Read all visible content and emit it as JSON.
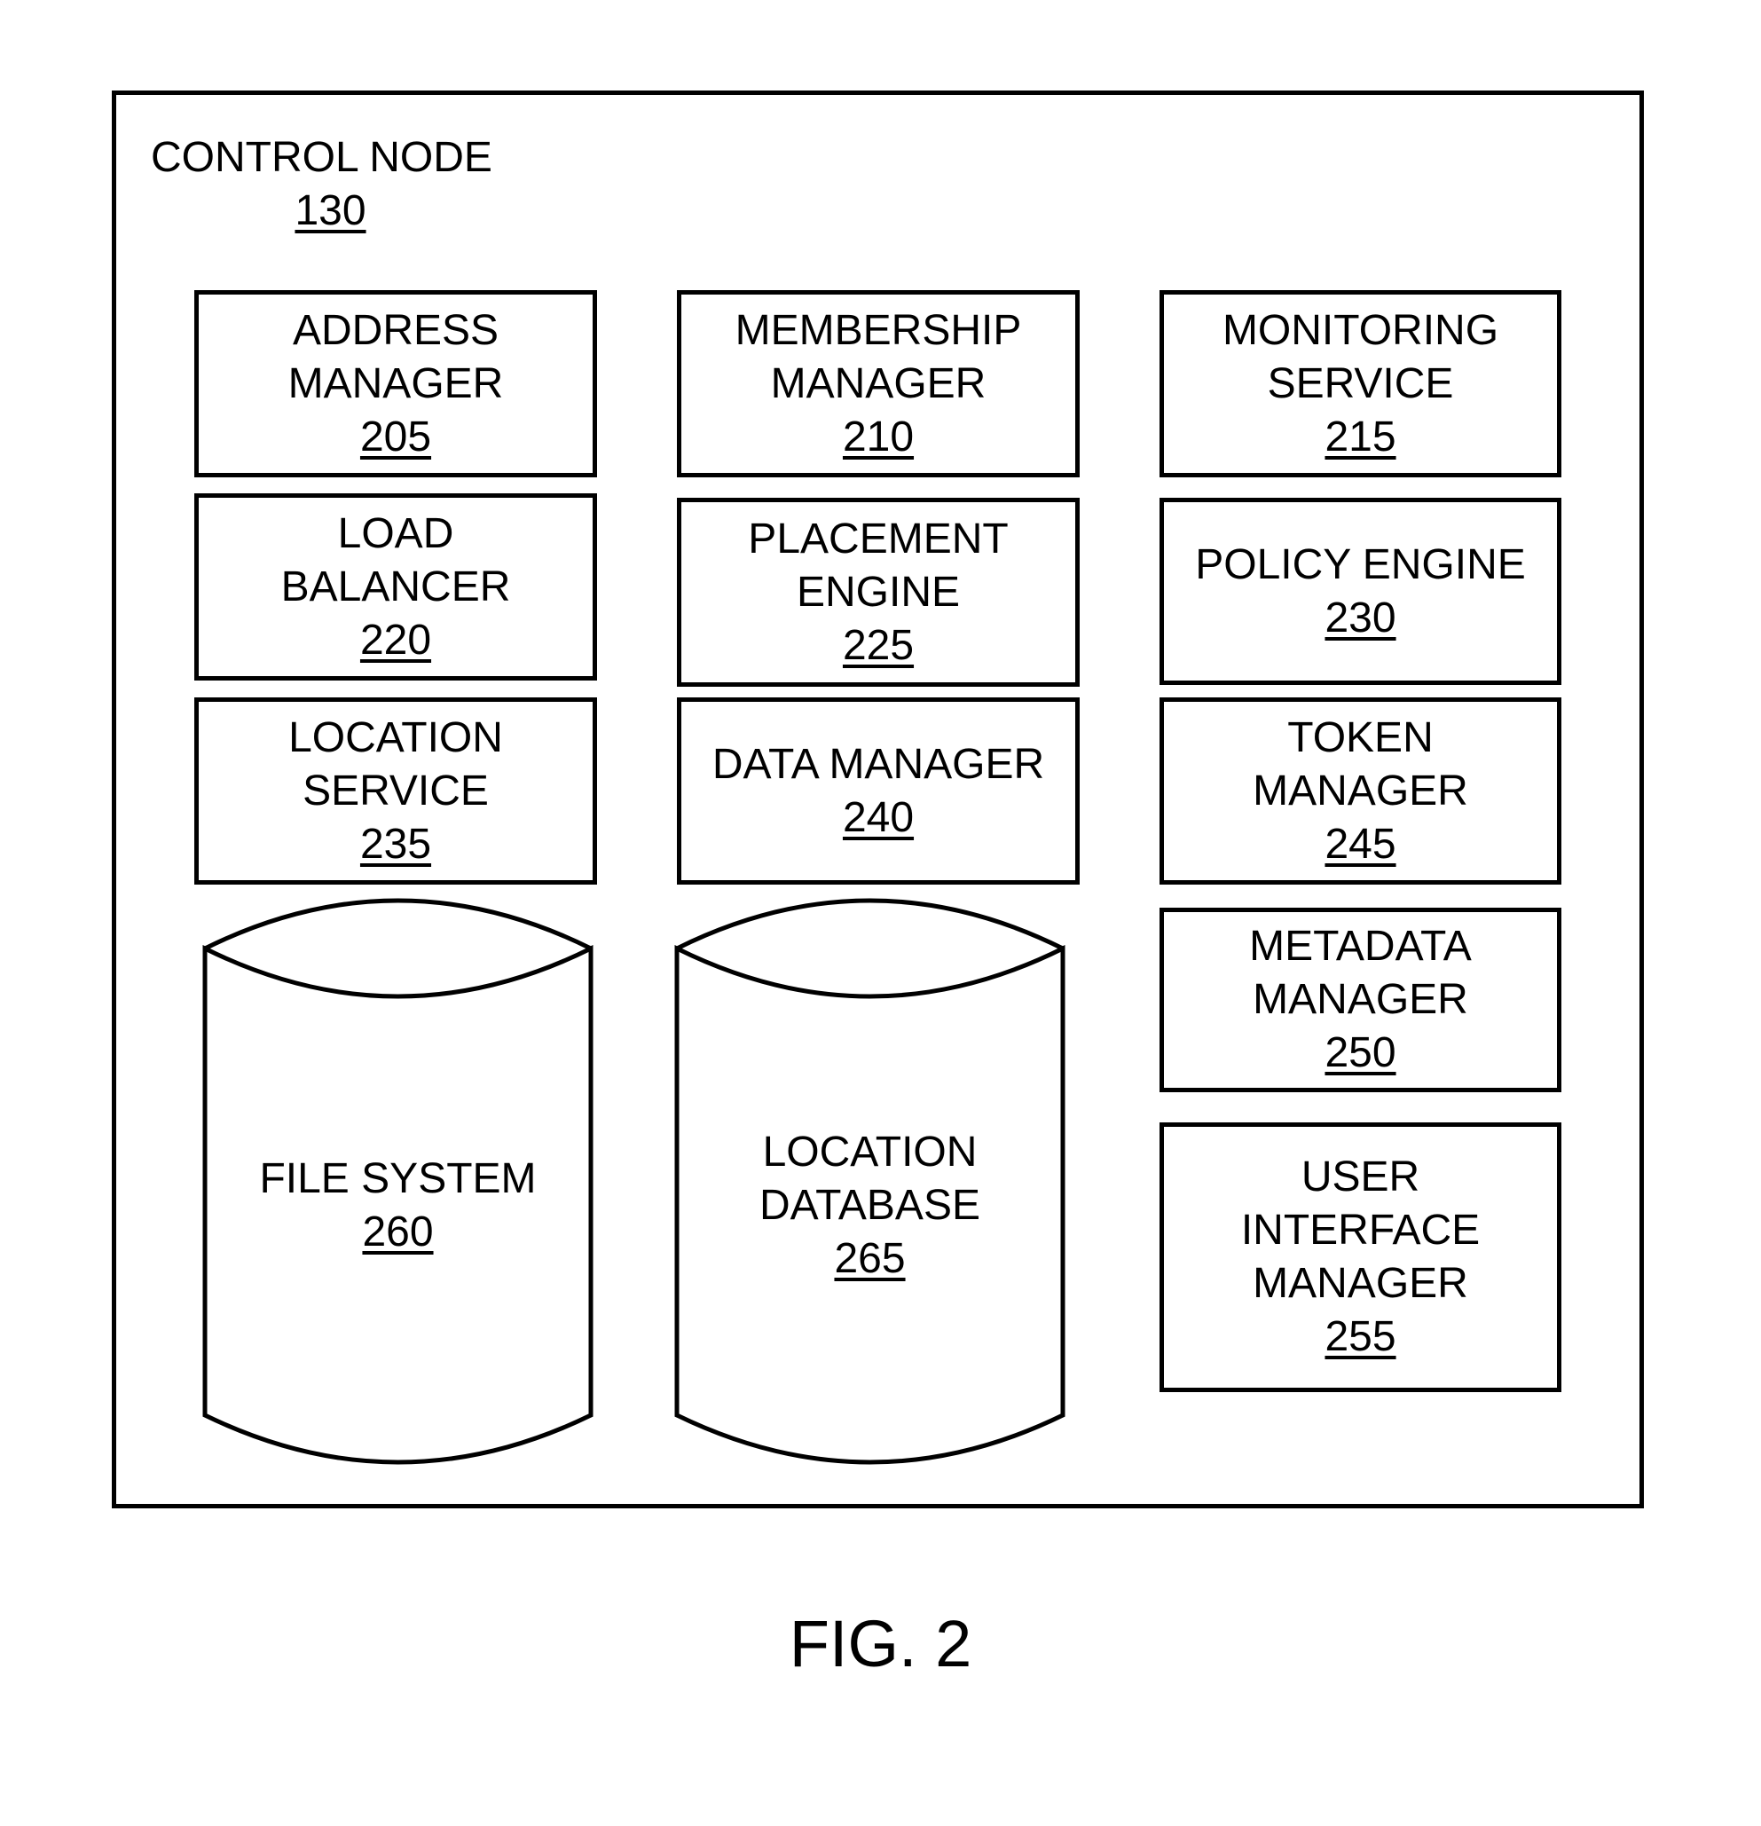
{
  "figure": {
    "label": "FIG. 2"
  },
  "control_node": {
    "title": "CONTROL NODE",
    "ref": "130"
  },
  "components": {
    "address_manager": {
      "lines": [
        "ADDRESS",
        "MANAGER"
      ],
      "ref": "205"
    },
    "membership_manager": {
      "lines": [
        "MEMBERSHIP",
        "MANAGER"
      ],
      "ref": "210"
    },
    "monitoring_service": {
      "lines": [
        "MONITORING",
        "SERVICE"
      ],
      "ref": "215"
    },
    "load_balancer": {
      "lines": [
        "LOAD",
        "BALANCER"
      ],
      "ref": "220"
    },
    "placement_engine": {
      "lines": [
        "PLACEMENT",
        "ENGINE"
      ],
      "ref": "225"
    },
    "policy_engine": {
      "lines": [
        "POLICY ENGINE"
      ],
      "ref": "230"
    },
    "location_service": {
      "lines": [
        "LOCATION",
        "SERVICE"
      ],
      "ref": "235"
    },
    "data_manager": {
      "lines": [
        "DATA MANAGER"
      ],
      "ref": "240"
    },
    "token_manager": {
      "lines": [
        "TOKEN",
        "MANAGER"
      ],
      "ref": "245"
    },
    "metadata_manager": {
      "lines": [
        "METADATA",
        "MANAGER"
      ],
      "ref": "250"
    },
    "user_interface_manager": {
      "lines": [
        "USER",
        "INTERFACE",
        "MANAGER"
      ],
      "ref": "255"
    }
  },
  "storage": {
    "file_system": {
      "lines": [
        "FILE SYSTEM"
      ],
      "ref": "260"
    },
    "location_database": {
      "lines": [
        "LOCATION",
        "DATABASE"
      ],
      "ref": "265"
    }
  }
}
